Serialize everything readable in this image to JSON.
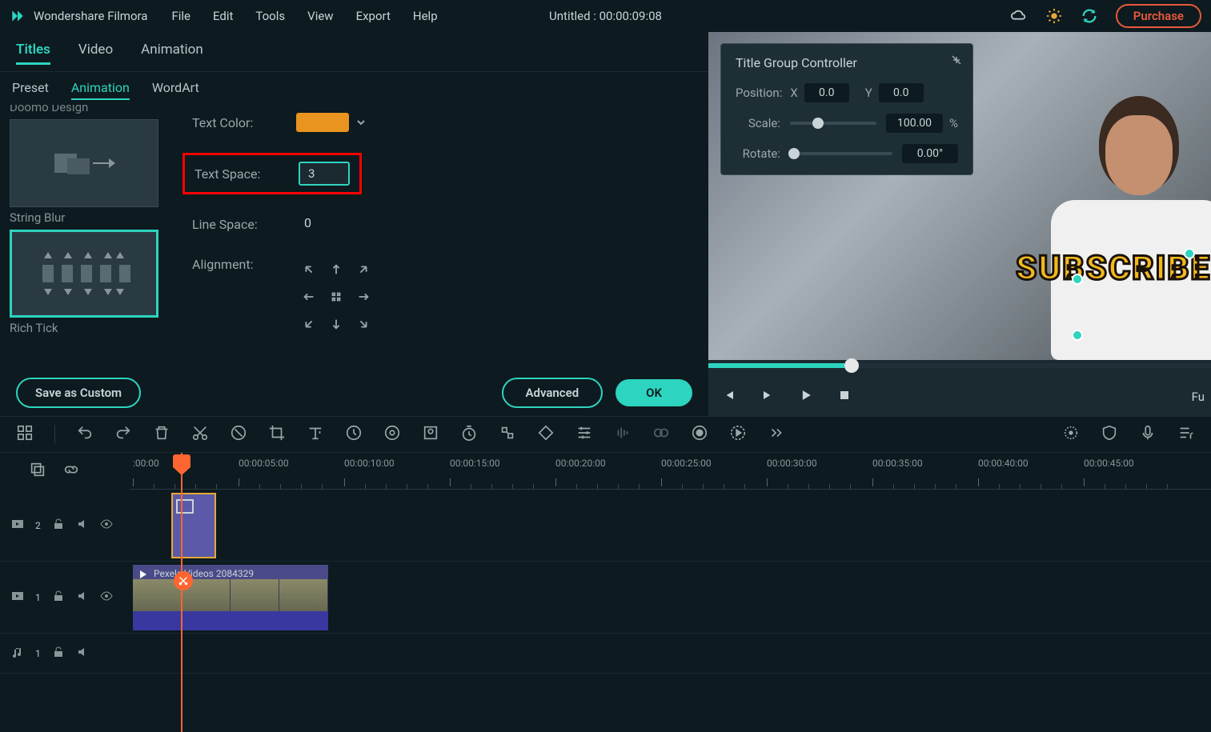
{
  "titlebar": {
    "app_name": "Wondershare Filmora",
    "menu": [
      "File",
      "Edit",
      "Tools",
      "View",
      "Export",
      "Help"
    ],
    "project": "Untitled : 00:00:09:08",
    "purchase": "Purchase"
  },
  "tabs_top": [
    {
      "label": "Titles",
      "active": true
    },
    {
      "label": "Video",
      "active": false
    },
    {
      "label": "Animation",
      "active": false
    }
  ],
  "tabs_sub": [
    {
      "label": "Preset",
      "active": false
    },
    {
      "label": "Animation",
      "active": true
    },
    {
      "label": "WordArt",
      "active": false
    }
  ],
  "presets": [
    {
      "name": "Doomo Design",
      "selected": false
    },
    {
      "name": "String Blur",
      "selected": false
    },
    {
      "name": "Rich Tick",
      "selected": true
    }
  ],
  "props": {
    "text_color_label": "Text Color:",
    "text_color": "#e8941f",
    "text_space_label": "Text Space:",
    "text_space": "3",
    "line_space_label": "Line Space:",
    "line_space": "0",
    "alignment_label": "Alignment:"
  },
  "buttons": {
    "save": "Save as Custom",
    "advanced": "Advanced",
    "ok": "OK"
  },
  "float_panel": {
    "title": "Title Group Controller",
    "position_label": "Position:",
    "x_label": "X",
    "x_val": "0.0",
    "y_label": "Y",
    "y_val": "0.0",
    "scale_label": "Scale:",
    "scale_val": "100.00",
    "scale_unit": "%",
    "rotate_label": "Rotate:",
    "rotate_val": "0.00°"
  },
  "preview": {
    "overlay_text": "SUBSCRIBE",
    "fu_label": "Fu"
  },
  "timeline": {
    "ticks": [
      ":00:00",
      "00:00:05:00",
      "00:00:10:00",
      "00:00:15:00",
      "00:00:20:00",
      "00:00:25:00",
      "00:00:30:00",
      "00:00:35:00",
      "00:00:40:00",
      "00:00:45:00"
    ],
    "track1_num": "2",
    "track2_num": "1",
    "track3_num": "1",
    "clip_name": "Pexels Videos 2084329"
  }
}
